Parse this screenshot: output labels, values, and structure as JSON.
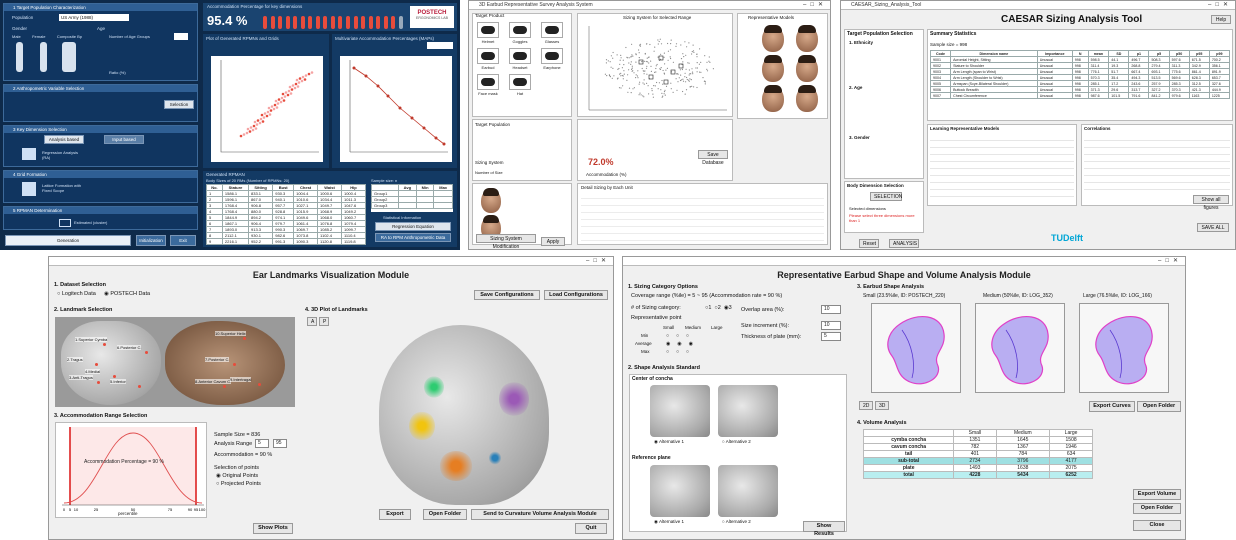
{
  "windows": {
    "p1": {
      "sec1": "1  Target Population Characterization",
      "population_label": "Population",
      "population_value": "US Army (1988)",
      "gender_label": "Gender",
      "genders": [
        "Male",
        "Female",
        "Composite Bp"
      ],
      "age_label": "Age",
      "age_groups_label": "Number of Age Groups",
      "ratio_label": "Ratio (%)",
      "sec2": "2  Anthropometric Variable Selection",
      "selection_btn": "Selection",
      "sec3": "3  Key Dimension Selection",
      "analysis_based": "Analysis based",
      "input_based": "Input based",
      "regression_label": "Regression Analysis (RA)",
      "sec4": "4  Grid Formation",
      "lattice_label": "Lattice Formation with Fixed Scope",
      "sec5": "5  RPMAN Determination",
      "estimated_label": "Estimated (cluster)",
      "generation_btn": "Generation",
      "initialization_btn": "Initialization",
      "exit_btn": "Exit",
      "accommodation_label": "Accommodation Percentage for key dimensions",
      "accommodation_value": "95.4 %",
      "logo_text": "POSTECH",
      "logo_sub": "ERGONOMICS LAB",
      "plot_left_title": "Plot of Generated RPMNs and Grids",
      "plot_right_title": "Multivariate Accommodation Percentages (MAPs)",
      "generated_title": "Generated RPMAN",
      "body_size_label": "Body Sizes of 20 RMs (Number of RPMNs: 20)",
      "sample_size_label": "Sample size: n",
      "stats_cols": [
        "Avg",
        "Min",
        "Max"
      ],
      "stats_rows": [
        "Group1",
        "Group2",
        "Group3"
      ],
      "stat_info_label": "Statistical Information",
      "regression_btn": "Regression Equation",
      "export_btn": "RA to RPM Anthropometric Data",
      "table_cols": [
        "No.",
        "Stature",
        "Sitting",
        "Bust",
        "Chest",
        "Waist",
        "Hip"
      ],
      "table_rows": [
        [
          "1",
          "1586.1",
          "833.1",
          "930.3",
          "1004.4",
          "1000.6",
          "1000.4"
        ],
        [
          "2",
          "1596.1",
          "867.0",
          "940.1",
          "1010.6",
          "1034.4",
          "1011.3"
        ],
        [
          "3",
          "1768.4",
          "906.8",
          "957.7",
          "1027.1",
          "1049.7",
          "1047.6"
        ],
        [
          "4",
          "1768.4",
          "880.0",
          "928.8",
          "1015.9",
          "1068.9",
          "1049.2"
        ],
        [
          "5",
          "1844.9",
          "894.2",
          "974.1",
          "1049.6",
          "1068.0",
          "1060.7"
        ],
        [
          "6",
          "1867.1",
          "906.4",
          "979.7",
          "1061.4",
          "1076.8",
          "1079.4"
        ],
        [
          "7",
          "1893.0",
          "913.3",
          "990.3",
          "1069.7",
          "1085.2",
          "1099.7"
        ],
        [
          "8",
          "2112.1",
          "930.1",
          "982.6",
          "1073.8",
          "1102.4",
          "1110.4"
        ],
        [
          "9",
          "2216.1",
          "952.2",
          "991.3",
          "1090.3",
          "1120.8",
          "1119.8"
        ]
      ]
    },
    "p2": {
      "title": "3D Earbud Representative Survey Analysis System",
      "target_product_label": "Target Product",
      "scatter_title": "Sizing System for Selected Range",
      "rep_models_label": "Representative Models",
      "target_population_label": "Target Population",
      "sizing_system_label": "Sizing System",
      "number_of_sizes_label": "Number of Size",
      "accommodation_label": "Accommodation (%)",
      "accommodation_value": "72.0%",
      "sizing_system_button": "Sizing System Modification",
      "save_data_button": "Save Database",
      "apply_button": "Apply",
      "sizing_results_label": "Detail Sizing by Each Unit",
      "products": [
        "Helmet",
        "Goggles",
        "Glasses",
        "Earbud",
        "Headset",
        "Earphone",
        "Face mask",
        "Hat"
      ]
    },
    "p3": {
      "app_title": "CAESAR_Sizing_Analysis_Tool",
      "main_title": "CAESAR Sizing Analysis Tool",
      "help_btn": "Help",
      "target_pop_label": "Target Population Selection",
      "ethnicity_label": "1. Ethnicity",
      "age_label": "2. Age",
      "gender_label": "3. Gender",
      "summary_label": "Summary Statistics",
      "sample_size": "Sample size = 998",
      "body_dim_label": "Body Dimension Selection",
      "selection_btn": "SELECTION",
      "selected_dims_label": "Selected dimensions",
      "selected_dims_warn": "Please select three dimensions more than 1",
      "learning_label": "Learning Representative Models",
      "correlations_label": "Correlations",
      "show_all_btn": "Show all figures",
      "save_all_btn": "SAVE ALL",
      "reset_btn": "Reset",
      "analysis_btn": "ANALYSIS",
      "tu_logo": "TUDelft",
      "summary_cols": [
        "Code",
        "Dimension name",
        "Importance",
        "N",
        "mean",
        "SD",
        "p1",
        "p5",
        "p50",
        "p95",
        "p99"
      ],
      "summary_rows": [
        [
          "9001",
          "Acromial Height, Sitting",
          "Unusual",
          "998",
          "598.5",
          "44.1",
          "496.7",
          "508.3",
          "597.6",
          "671.5",
          "700.2"
        ],
        [
          "9002",
          "Stature to Shoulder",
          "Unusual",
          "998",
          "311.4",
          "19.3",
          "268.8",
          "279.4",
          "311.3",
          "342.9",
          "356.1"
        ],
        [
          "9003",
          "Arm Length (span to Wrist)",
          "Unusual",
          "998",
          "776.1",
          "51.7",
          "667.4",
          "693.1",
          "775.6",
          "861.4",
          "891.9"
        ],
        [
          "9004",
          "Arm Length (Shoulder to Wrist)",
          "Unusual",
          "998",
          "570.3",
          "35.4",
          "494.3",
          "513.5",
          "569.6",
          "628.3",
          "653.7"
        ],
        [
          "9005",
          "Armspan (Scye-Bilateral Shoulder)",
          "Unusual",
          "998",
          "285.1",
          "17.2",
          "243.6",
          "257.9",
          "285.3",
          "312.5",
          "327.6"
        ],
        [
          "9006",
          "Buttock Breadth",
          "Unusual",
          "998",
          "371.3",
          "29.6",
          "313.7",
          "327.2",
          "370.3",
          "421.3",
          "444.9"
        ],
        [
          "9007",
          "Chest Circumference",
          "Unusual",
          "998",
          "987.6",
          "101.5",
          "791.6",
          "841.2",
          "979.6",
          "1163",
          "1225"
        ]
      ]
    },
    "p4": {
      "title": "Ear Landmarks Visualization Module",
      "sec1": "1. Dataset Selection",
      "opt1": "Logitech Data",
      "opt2": "POSTECH Data",
      "save_config_btn": "Save Configurations",
      "load_config_btn": "Load Configurations",
      "sec2": "2. Landmark Selection",
      "sec3": "3. Accommodation Range Selection",
      "sec4": "4. 3D Plot of Landmarks",
      "btn_a": "A",
      "btn_p": "P",
      "sample_size": "Sample Size = 836",
      "analysis_range_label": "Analysis Range",
      "range_low": "5",
      "range_high": "95",
      "accommodation": "Accommodation = 90 %",
      "selection_label": "Selection of points",
      "original_points": "Original Points",
      "projected_points": "Projected Points",
      "curve_label": "Accommodation Percentage = 90 %",
      "x_axis_label": "percentile",
      "show_plots_btn": "Show Plots",
      "export_btn": "Export",
      "open_folder_btn": "Open Folder",
      "send_btn": "Send to Curvature Volume Analysis Module",
      "quit_btn": "Quit",
      "landmarks": [
        "1.Superior Cymba",
        "2.Tragus",
        "3.Anti-Tragus",
        "4.Medial",
        "5.Inferior",
        "6.Posterior C.",
        "7.Posterior C.",
        "8.Anterior Cavum C.",
        "9.Intertragal",
        "10.Superior Helix"
      ],
      "x_ticks": [
        "0",
        "5",
        "10",
        "25",
        "50",
        "75",
        "90",
        "95",
        "100"
      ]
    },
    "p5": {
      "title": "Representative Earbud Shape and Volume Analysis Module",
      "sec1": "1. Sizing Category Options",
      "coverage_label": "Coverage range (%ile) = 5 ~ 95 (Accommodation rate = 90 %)",
      "num_category_label": "# of Sizing category:",
      "rep_point_label": "Representative point",
      "small_label": "Small",
      "medium_label": "Medium",
      "large_label": "Large",
      "min_label": "Min",
      "avg_label": "Average",
      "max_label": "Max",
      "overlap_label": "Overlap area (%):",
      "overlap_value": "10",
      "size_inc_label": "Size increment (%):",
      "size_inc_value": "10",
      "thickness_label": "Thickness of plate (mm):",
      "thickness_value": "5",
      "sec2": "2. Shape Analysis Standard",
      "center_concha": "Center of concha",
      "reference_plane": "Reference plane",
      "alt1": "Alternative 1",
      "alt2": "Alternative 2",
      "show_results_btn": "Show Results",
      "sec3": "3. Earbud Shape Analysis",
      "small_caption": "Small (23.5%ile, ID: POSTECH_220)",
      "medium_caption": "Medium (50%ile, ID: LOG_352)",
      "large_caption": "Large (76.5%ile, ID: LOG_166)",
      "btn_2d": "2D",
      "btn_3d": "3D",
      "export_curves_btn": "Export Curves",
      "open_folder_btn": "Open Folder",
      "sec4": "4. Volume Analysis",
      "volume_cols": [
        "",
        "Small",
        "Medium",
        "Large"
      ],
      "volume_rows": [
        [
          "cymba concha",
          "1351",
          "1645",
          "1508"
        ],
        [
          "cavum concha",
          "782",
          "1367",
          "1946"
        ],
        [
          "tail",
          "401",
          "784",
          "634"
        ],
        [
          "sub-total",
          "2734",
          "3796",
          "4177"
        ],
        [
          "plate",
          "1493",
          "1638",
          "2075"
        ],
        [
          "total",
          "4228",
          "5434",
          "6252"
        ]
      ],
      "export_volume_btn": "Export Volume",
      "open_folder_btn2": "Open Folder",
      "close_btn": "Close"
    }
  },
  "colors": {
    "dark_bg": "#0e2a4a",
    "section_bar": "#2f5f94",
    "accent_red": "#d22",
    "highlight_cyan": "#9fe0e2",
    "curve_red": "#e05050"
  }
}
